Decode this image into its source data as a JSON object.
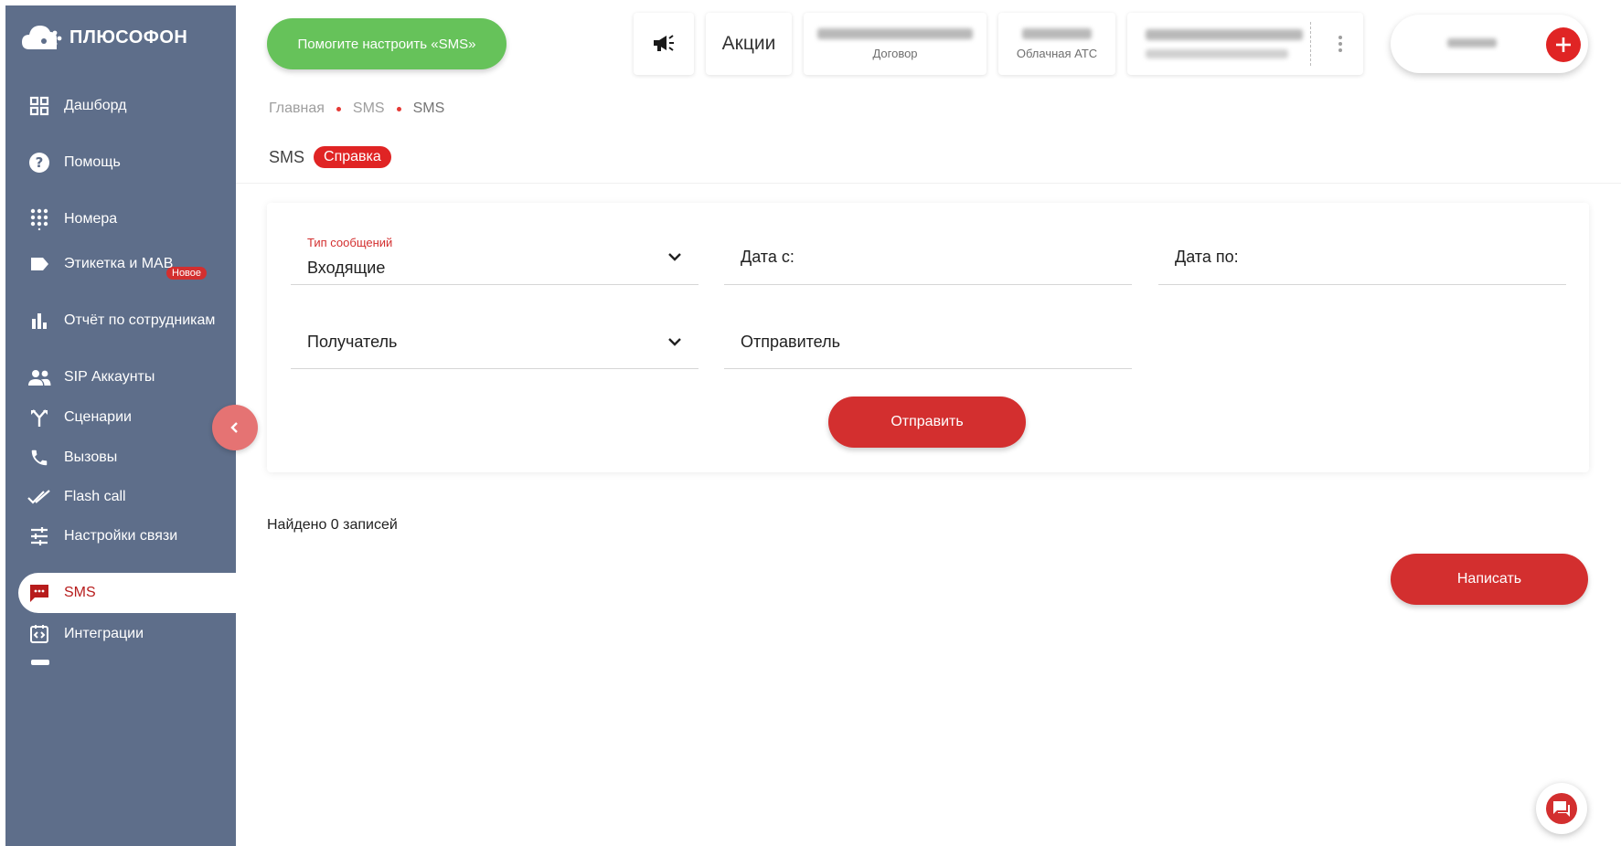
{
  "brand": {
    "name": "ПЛЮСОФОН"
  },
  "sidebar": {
    "items": [
      {
        "label": "Дашборд",
        "icon": "dashboard-icon"
      },
      {
        "label": "Помощь",
        "icon": "help-icon"
      },
      {
        "label": "Номера",
        "icon": "dialpad-icon"
      },
      {
        "label": "Этикетка и МАВ",
        "icon": "label-icon"
      },
      {
        "label": "Отчёт по сотрудникам",
        "icon": "bar-chart-icon"
      },
      {
        "label": "SIP Аккаунты",
        "icon": "users-icon"
      },
      {
        "label": "Сценарии",
        "icon": "fork-icon"
      },
      {
        "label": "Вызовы",
        "icon": "phone-icon"
      },
      {
        "label": "Flash call",
        "icon": "double-check-icon"
      },
      {
        "label": "Настройки связи",
        "icon": "sliders-icon"
      },
      {
        "label": "SMS",
        "icon": "sms-icon",
        "active": true
      },
      {
        "label": "Интеграции",
        "icon": "integration-icon"
      }
    ],
    "new_badge": "Новое"
  },
  "topbar": {
    "help_button": "Помогите настроить «SMS»",
    "promo_label": "Акции",
    "contract_label": "Договор",
    "pbx_label": "Облачная АТС"
  },
  "breadcrumb": [
    "Главная",
    "SMS",
    "SMS"
  ],
  "page": {
    "title": "SMS",
    "help_chip": "Справка"
  },
  "filters": {
    "type_label": "Тип сообщений",
    "type_value": "Входящие",
    "date_from": "Дата с:",
    "date_to": "Дата по:",
    "recipient": "Получатель",
    "sender": "Отправитель",
    "submit": "Отправить"
  },
  "results": {
    "found": "Найдено 0 записей"
  },
  "actions": {
    "write": "Написать"
  },
  "colors": {
    "sidebar": "#5e6e8a",
    "accent": "#d32f2f",
    "help_green": "#66c25a"
  }
}
